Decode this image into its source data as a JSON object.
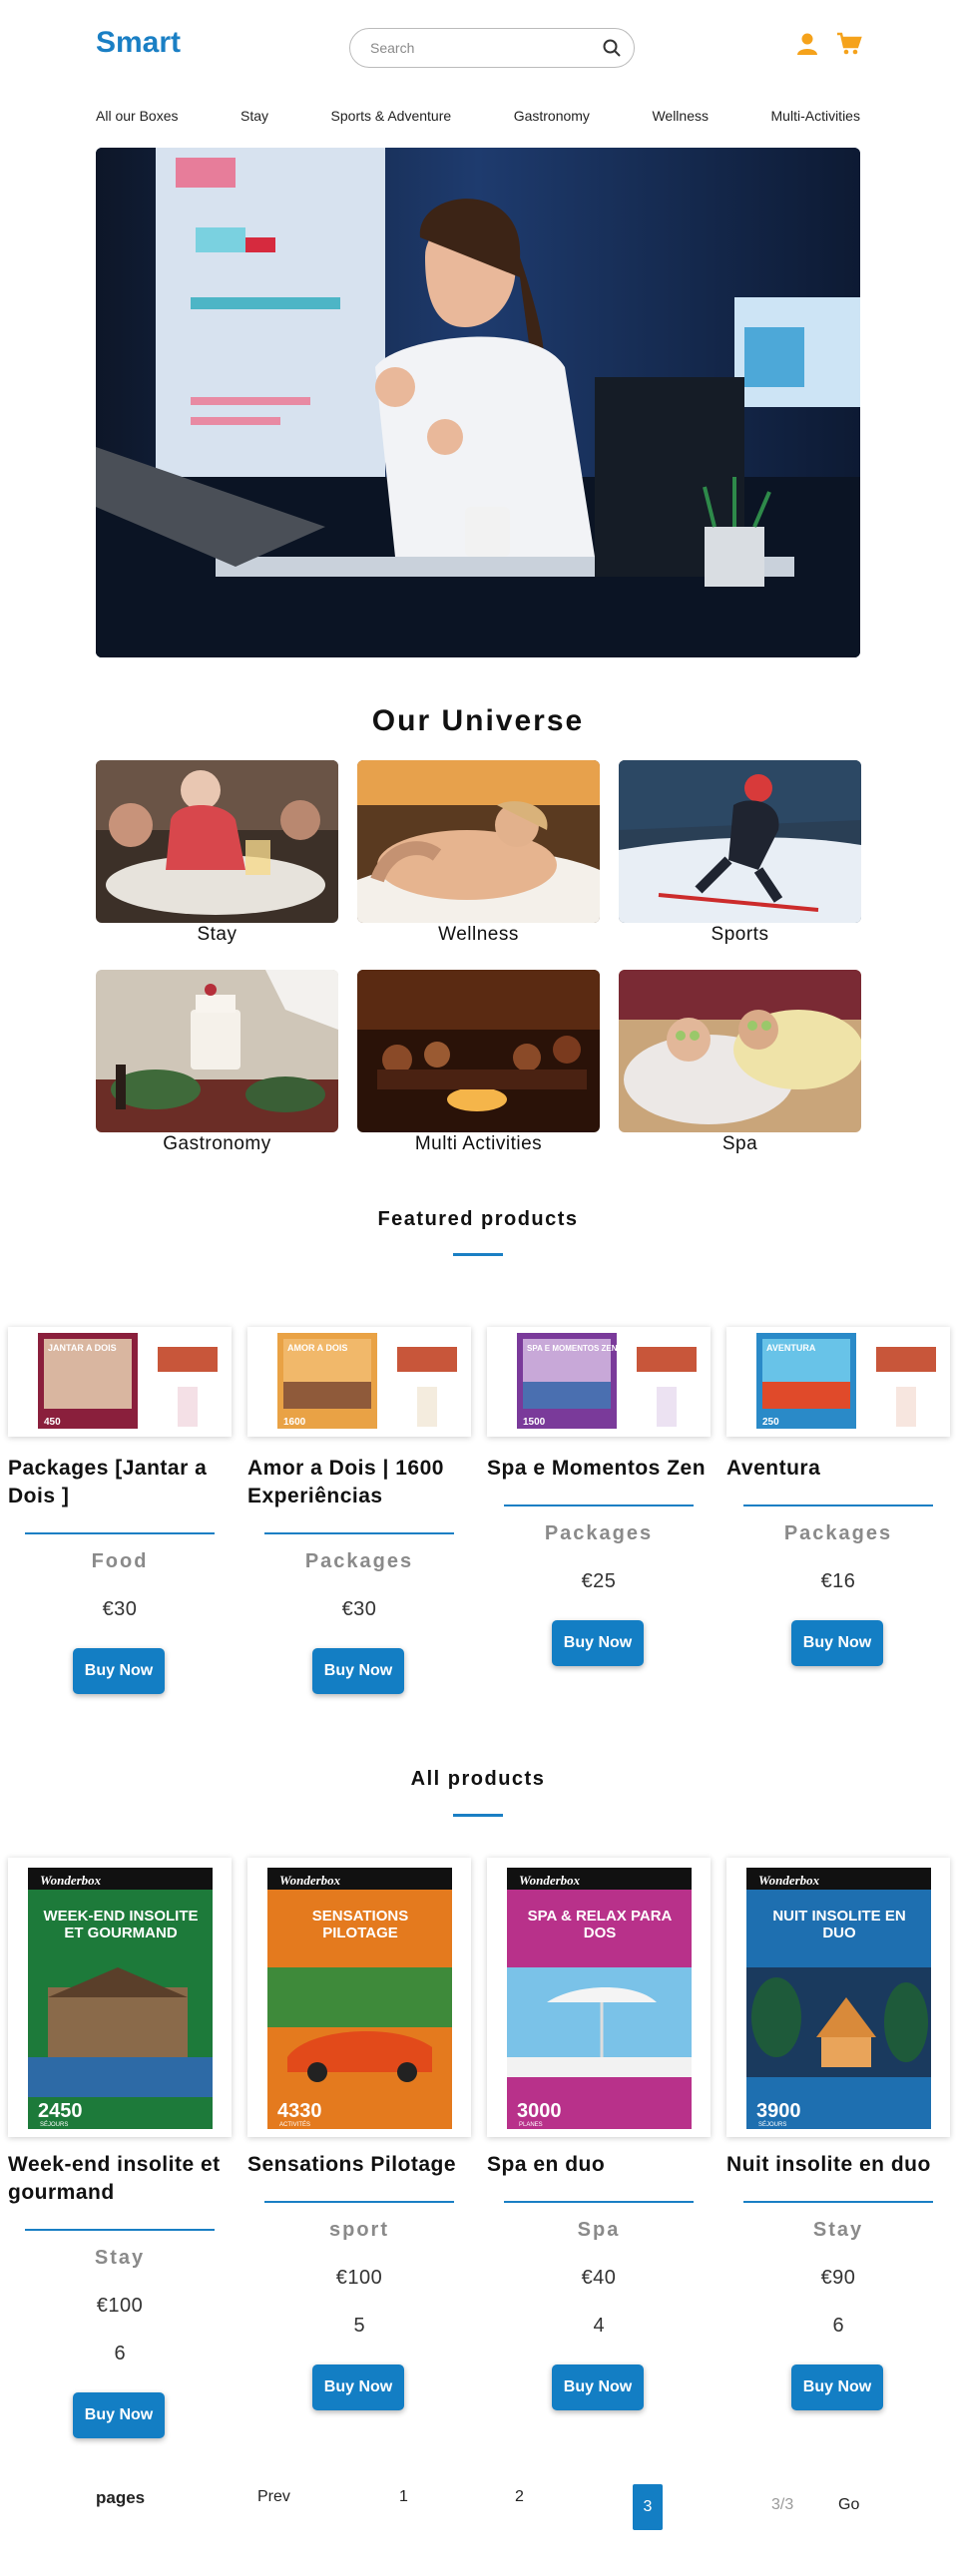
{
  "header": {
    "logo": "Smart",
    "search_placeholder": "Search",
    "icons": {
      "search": "search-icon",
      "user": "user-icon",
      "cart": "cart-icon"
    },
    "accent_color": "#1a7fc4",
    "icon_color": "#f5a21b"
  },
  "nav": [
    "All our Boxes",
    "Stay",
    "Sports & Adventure",
    "Gastronomy",
    "Wellness",
    "Multi-Activities"
  ],
  "universe": {
    "title": "Our Universe",
    "items": [
      "Stay",
      "Wellness",
      "Sports",
      "Gastronomy",
      "Multi Activities",
      "Spa"
    ]
  },
  "featured": {
    "title": "Featured products",
    "products": [
      {
        "name": "Packages [Jantar a Dois ]",
        "category": "Food",
        "price": "€30",
        "button": "Buy Now",
        "cover": "JANTAR A DOIS",
        "count": "450"
      },
      {
        "name": "Amor a Dois | 1600 Experiências",
        "category": "Packages",
        "price": "€30",
        "button": "Buy Now",
        "cover": "AMOR A DOIS",
        "count": "1600"
      },
      {
        "name": "Spa e Momentos Zen",
        "category": "Packages",
        "price": "€25",
        "button": "Buy Now",
        "cover": "SPA E MOMENTOS ZEN",
        "count": "1500"
      },
      {
        "name": "Aventura",
        "category": "Packages",
        "price": "€16",
        "button": "Buy Now",
        "cover": "AVENTURA",
        "count": "250"
      }
    ]
  },
  "all_products": {
    "title": "All products",
    "products": [
      {
        "name": "Week-end insolite et gourmand",
        "category": "Stay",
        "price": "€100",
        "quantity": "6",
        "button": "Buy Now",
        "brand": "Wonderbox",
        "cover": "WEEK-END INSOLITE ET GOURMAND",
        "count": "2450",
        "count_label": "SÉJOURS"
      },
      {
        "name": "Sensations Pilotage",
        "category": "sport",
        "price": "€100",
        "quantity": "5",
        "button": "Buy Now",
        "brand": "Wonderbox",
        "cover": "SENSATIONS PILOTAGE",
        "count": "4330",
        "count_label": "ACTIVITÉS"
      },
      {
        "name": "Spa en duo",
        "category": "Spa",
        "price": "€40",
        "quantity": "4",
        "button": "Buy Now",
        "brand": "Wonderbox",
        "cover": "SPA & RELAX PARA DOS",
        "count": "3000",
        "count_label": "PLANES"
      },
      {
        "name": "Nuit insolite en duo",
        "category": "Stay",
        "price": "€90",
        "quantity": "6",
        "button": "Buy Now",
        "brand": "Wonderbox",
        "cover": "NUIT INSOLITE EN DUO",
        "count": "3900",
        "count_label": "SÉJOURS"
      }
    ]
  },
  "pagination": {
    "label": "pages",
    "prev": "Prev",
    "pages": [
      "1",
      "2",
      "3"
    ],
    "current": "3",
    "counter": "3/3",
    "go": "Go"
  }
}
